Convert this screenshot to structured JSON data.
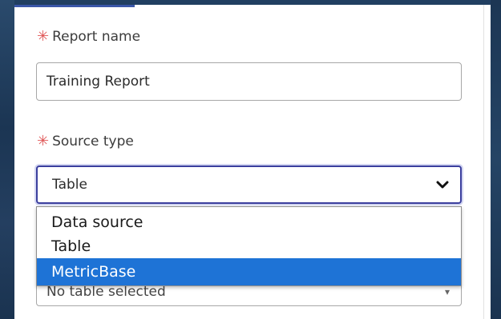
{
  "form": {
    "report_name": {
      "required_mark": "✳",
      "label": "Report name",
      "value": "Training Report"
    },
    "source_type": {
      "required_mark": "✳",
      "label": "Source type",
      "selected_value": "Table",
      "icon": "chevron-down-icon",
      "options": [
        {
          "label": "Data source",
          "highlighted": false
        },
        {
          "label": "Table",
          "highlighted": false
        },
        {
          "label": "MetricBase",
          "highlighted": true
        }
      ]
    },
    "table": {
      "value": "No table selected"
    }
  },
  "colors": {
    "required": "#e05858",
    "focus_border": "#3b3f9e",
    "highlight": "#1e73d6",
    "tab_underline": "#3a56a8"
  }
}
